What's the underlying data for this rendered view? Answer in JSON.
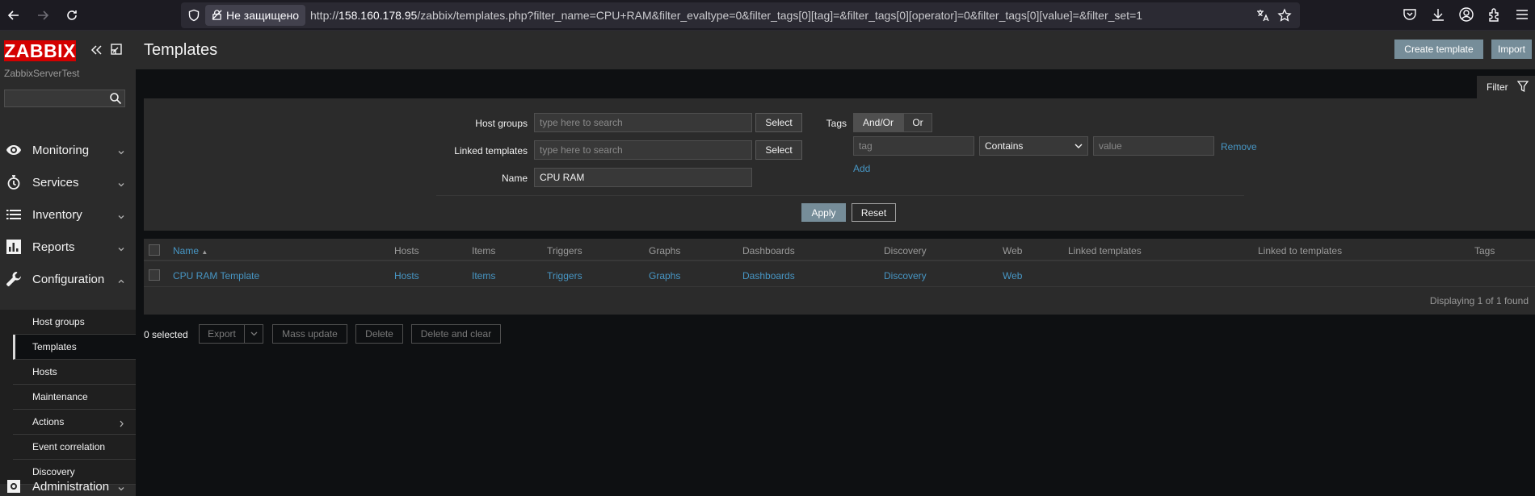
{
  "browser": {
    "not_secure_label": "Не защищено",
    "url_prefix": "http://",
    "url_host": "158.160.178.95",
    "url_rest": "/zabbix/templates.php?filter_name=CPU+RAM&filter_evaltype=0&filter_tags[0][tag]=&filter_tags[0][operator]=0&filter_tags[0][value]=&filter_set=1"
  },
  "sidebar": {
    "logo": "ZABBIX",
    "server_name": "ZabbixServerTest",
    "menu": [
      {
        "label": "Monitoring",
        "icon": "eye-icon"
      },
      {
        "label": "Services",
        "icon": "stopwatch-icon"
      },
      {
        "label": "Inventory",
        "icon": "list-icon"
      },
      {
        "label": "Reports",
        "icon": "chart-icon"
      },
      {
        "label": "Configuration",
        "icon": "wrench-icon"
      },
      {
        "label": "Administration",
        "icon": "gear-icon"
      }
    ],
    "submenu": [
      {
        "label": "Host groups"
      },
      {
        "label": "Templates"
      },
      {
        "label": "Hosts"
      },
      {
        "label": "Maintenance"
      },
      {
        "label": "Actions"
      },
      {
        "label": "Event correlation"
      },
      {
        "label": "Discovery"
      }
    ]
  },
  "header": {
    "title": "Templates",
    "create_label": "Create template",
    "import_label": "Import"
  },
  "filter": {
    "tab_label": "Filter",
    "host_groups_label": "Host groups",
    "linked_templates_label": "Linked templates",
    "name_label": "Name",
    "search_placeholder": "type here to search",
    "name_value": "CPU RAM",
    "select_label": "Select",
    "tags_label": "Tags",
    "andor_label": "And/Or",
    "or_label": "Or",
    "tag_placeholder": "tag",
    "operator_value": "Contains",
    "value_placeholder": "value",
    "remove_label": "Remove",
    "add_label": "Add",
    "apply_label": "Apply",
    "reset_label": "Reset"
  },
  "table": {
    "columns": [
      "Name",
      "Hosts",
      "Items",
      "Triggers",
      "Graphs",
      "Dashboards",
      "Discovery",
      "Web",
      "Linked templates",
      "Linked to templates",
      "Tags"
    ],
    "sort_indicator": "▲",
    "rows": [
      {
        "name": "CPU RAM Template",
        "hosts": "Hosts",
        "items": "Items",
        "triggers": "Triggers",
        "graphs": "Graphs",
        "dashboards": "Dashboards",
        "discovery": "Discovery",
        "web": "Web"
      }
    ],
    "paging": "Displaying 1 of 1 found"
  },
  "actions": {
    "selected": "0 selected",
    "export_label": "Export",
    "mass_update_label": "Mass update",
    "delete_label": "Delete",
    "delete_clear_label": "Delete and clear"
  },
  "colors": {
    "accent": "#768d99",
    "link": "#4796c4",
    "logo": "#d40000"
  }
}
